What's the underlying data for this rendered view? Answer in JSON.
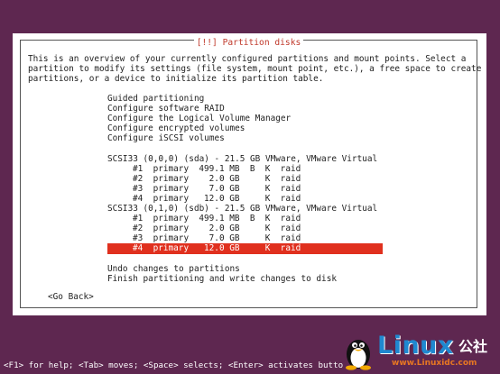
{
  "dialog": {
    "title": "[!!] Partition disks",
    "description": [
      "This is an overview of your currently configured partitions and mount points. Select a",
      "partition to modify its settings (file system, mount point, etc.), a free space to create",
      "partitions, or a device to initialize its partition table."
    ],
    "options": [
      "Guided partitioning",
      "Configure software RAID",
      "Configure the Logical Volume Manager",
      "Configure encrypted volumes",
      "Configure iSCSI volumes"
    ],
    "disks": [
      {
        "label": "SCSI33 (0,0,0) (sda) - 21.5 GB VMware, VMware Virtual S",
        "partitions": [
          "#1  primary  499.1 MB  B  K  raid",
          "#2  primary    2.0 GB     K  raid",
          "#3  primary    7.0 GB     K  raid",
          "#4  primary   12.0 GB     K  raid"
        ]
      },
      {
        "label": "SCSI33 (0,1,0) (sdb) - 21.5 GB VMware, VMware Virtual S",
        "partitions": [
          "#1  primary  499.1 MB  B  K  raid",
          "#2  primary    2.0 GB     K  raid",
          "#3  primary    7.0 GB     K  raid",
          "#4  primary   12.0 GB     K  raid"
        ]
      }
    ],
    "actions": [
      "Undo changes to partitions",
      "Finish partitioning and write changes to disk"
    ],
    "go_back": "<Go Back>"
  },
  "help_bar": "<F1> for help; <Tab> moves; <Space> selects; <Enter> activates butto",
  "watermark": {
    "word": "Linux",
    "cn": "公社",
    "url": "www.Linuxidc.com"
  },
  "colors": {
    "background": "#5e2750",
    "selection": "#e0301e",
    "title": "#c0392b"
  }
}
